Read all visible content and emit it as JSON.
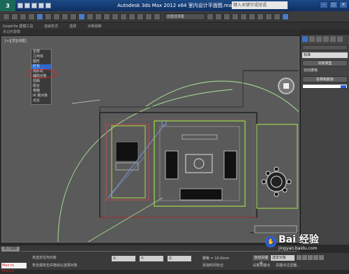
{
  "app": {
    "logo_text": "3",
    "title": "Autodesk 3ds Max  2012 x64    室内设计平面图.max",
    "search_placeholder": "键入关键字或短语",
    "window_buttons": [
      "–",
      "□",
      "×"
    ]
  },
  "toolbar": {
    "selection_set_label": "创建选择集"
  },
  "menubar": {
    "items": [
      "Graphite 建模工具",
      "自由形式",
      "选择",
      "对象绘制"
    ]
  },
  "ribbon": {
    "label": "多边形建模"
  },
  "viewport": {
    "label": "[+][顶][线框]"
  },
  "dropdown": {
    "items": [
      "全部",
      "几何体",
      "图形",
      "灯光",
      "摄影机",
      "辅助对象",
      "扭曲",
      "组合",
      "骨骼",
      "IK 链对象",
      "点云",
      "Frost"
    ],
    "highlighted_index": 3
  },
  "command_panel": {
    "dropdown_value": "标准",
    "rollout_object_type": "对象类型",
    "auto_grid_label": "自动栅格",
    "rollout_name_color": "名称和颜色",
    "accent_color": "#2b5bd8"
  },
  "timeline": {
    "frame_label": "0 / 100"
  },
  "status": {
    "maxscript_label": "Max to Physcs :",
    "line1": "未选定任何对象",
    "line2": "单击或单击并拖动以选择对象",
    "x_label": "X:",
    "y_label": "Y:",
    "z_label": "Z:",
    "grid_label": "栅格 = 10.0mm",
    "autokey_label": "自动关键点",
    "selected_label": "选定对象",
    "set_key_label": "设置关键点",
    "key_filters_label": "关键点过滤器...",
    "add_time_tag_label": "添加时间标记"
  },
  "watermark": {
    "text": "Bai 经验",
    "sub": "jingyan.baidu.com"
  }
}
